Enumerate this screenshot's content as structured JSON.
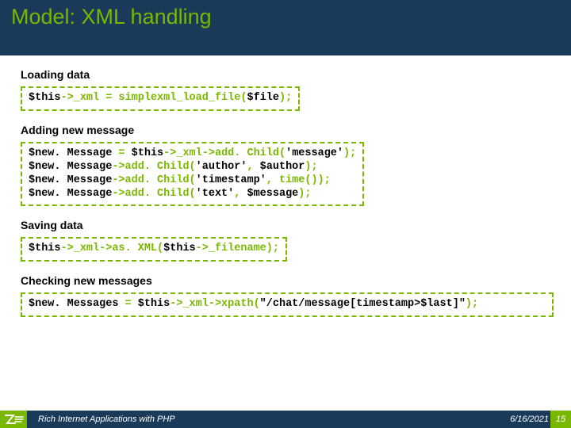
{
  "title": "Model: XML handling",
  "sections": [
    {
      "label": "Loading data",
      "full": false,
      "lines": [
        [
          {
            "t": "$this"
          },
          {
            "t": "->_xml = simplexml_load_file(",
            "hl": true
          },
          {
            "t": "$file"
          },
          {
            "t": ");",
            "hl": true
          }
        ]
      ]
    },
    {
      "label": "Adding new message",
      "full": false,
      "lines": [
        [
          {
            "t": "$new. Message"
          },
          {
            "t": " = ",
            "hl": true
          },
          {
            "t": "$this"
          },
          {
            "t": "->_xml->add. Child(",
            "hl": true
          },
          {
            "t": "'message'"
          },
          {
            "t": ");",
            "hl": true
          }
        ],
        [
          {
            "t": "$new. Message"
          },
          {
            "t": "->add. Child(",
            "hl": true
          },
          {
            "t": "'author'"
          },
          {
            "t": ", ",
            "hl": true
          },
          {
            "t": "$author"
          },
          {
            "t": ");",
            "hl": true
          }
        ],
        [
          {
            "t": "$new. Message"
          },
          {
            "t": "->add. Child(",
            "hl": true
          },
          {
            "t": "'timestamp'"
          },
          {
            "t": ", time());",
            "hl": true
          }
        ],
        [
          {
            "t": "$new. Message"
          },
          {
            "t": "->add. Child(",
            "hl": true
          },
          {
            "t": "'text'"
          },
          {
            "t": ", ",
            "hl": true
          },
          {
            "t": "$message"
          },
          {
            "t": ");",
            "hl": true
          }
        ]
      ]
    },
    {
      "label": "Saving data",
      "full": false,
      "lines": [
        [
          {
            "t": "$this"
          },
          {
            "t": "->_xml->as. XML(",
            "hl": true
          },
          {
            "t": "$this"
          },
          {
            "t": "->_filename);",
            "hl": true
          }
        ]
      ]
    },
    {
      "label": "Checking new messages",
      "full": true,
      "lines": [
        [
          {
            "t": "$new. Messages"
          },
          {
            "t": " = ",
            "hl": true
          },
          {
            "t": "$this"
          },
          {
            "t": "->_xml->xpath(",
            "hl": true
          },
          {
            "t": "\"/chat/message[timestamp>$last]\""
          },
          {
            "t": ");",
            "hl": true
          }
        ]
      ]
    }
  ],
  "footer": {
    "text": "Rich Internet Applications with PHP",
    "date": "6/16/2021",
    "page": "15"
  }
}
